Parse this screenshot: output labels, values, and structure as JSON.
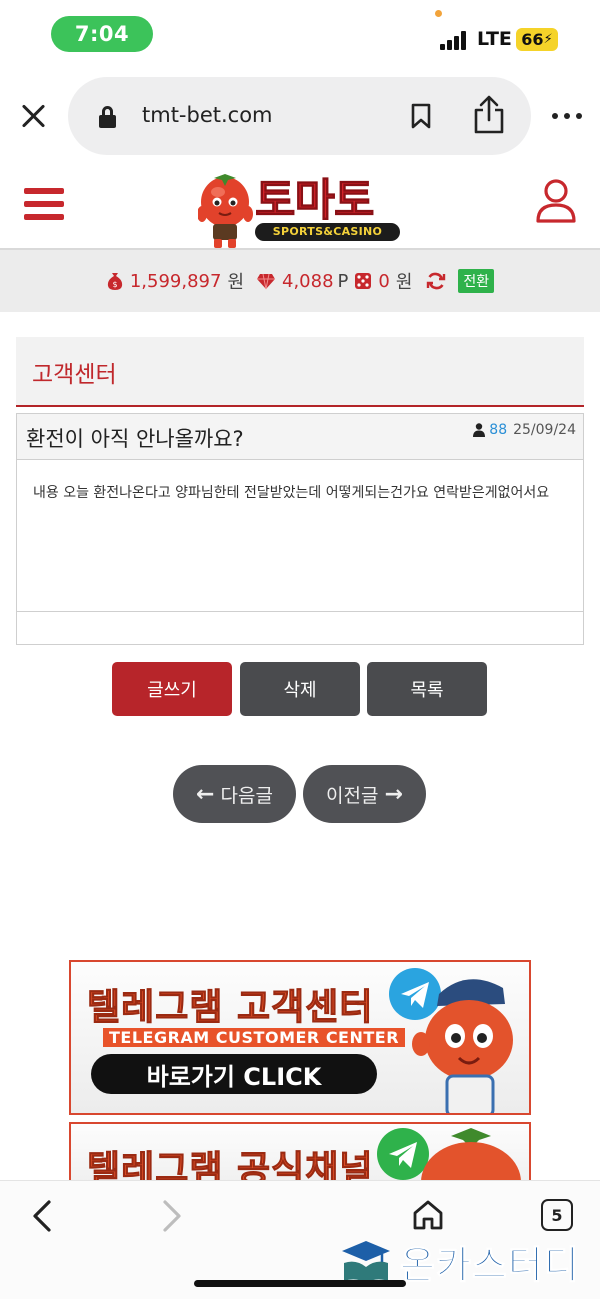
{
  "status_bar": {
    "time": "7:04",
    "network": "LTE",
    "battery": "66"
  },
  "browser": {
    "url": "tmt-bet.com",
    "tab_count": "5"
  },
  "site": {
    "logo_title": "토마토",
    "logo_subtitle": "SPORTS&CASINO"
  },
  "balance": {
    "money": "1,599,897",
    "money_unit": "원",
    "points": "4,088",
    "points_unit": "P",
    "casino": "0",
    "casino_unit": "원",
    "convert_label": "전환"
  },
  "section": {
    "title": "고객센터"
  },
  "post": {
    "title": "환전이 아직 안나올까요?",
    "author": "88",
    "date": "25/09/24",
    "body": "내용 오늘 환전나온다고 양파님한테 전달받았는데 어떻게되는건가요 연락받은게없어서요"
  },
  "buttons": {
    "write": "글쓰기",
    "delete": "삭제",
    "list": "목록",
    "next": "다음글",
    "prev": "이전글"
  },
  "banners": {
    "telegram_support_title": "텔레그램 고객센터",
    "telegram_support_sub": "TELEGRAM CUSTOMER CENTER",
    "telegram_support_cta": "바로가기 CLICK",
    "telegram_channel_title": "텔레그램 공식채널"
  },
  "watermark": "온카스터디",
  "colors": {
    "brand_red": "#c7282d",
    "convert_green": "#2fb24b",
    "dark_button": "#4a4b4e",
    "author_blue": "#2a8fd6"
  },
  "icons": [
    "close-icon",
    "lock-icon",
    "bookmark-icon",
    "share-icon",
    "more-icon",
    "hamburger-icon",
    "user-icon",
    "money-bag-icon",
    "gem-icon",
    "dice-icon",
    "refresh-icon",
    "person-icon",
    "telegram-icon",
    "back-icon",
    "forward-icon",
    "home-icon",
    "tabs-icon"
  ]
}
